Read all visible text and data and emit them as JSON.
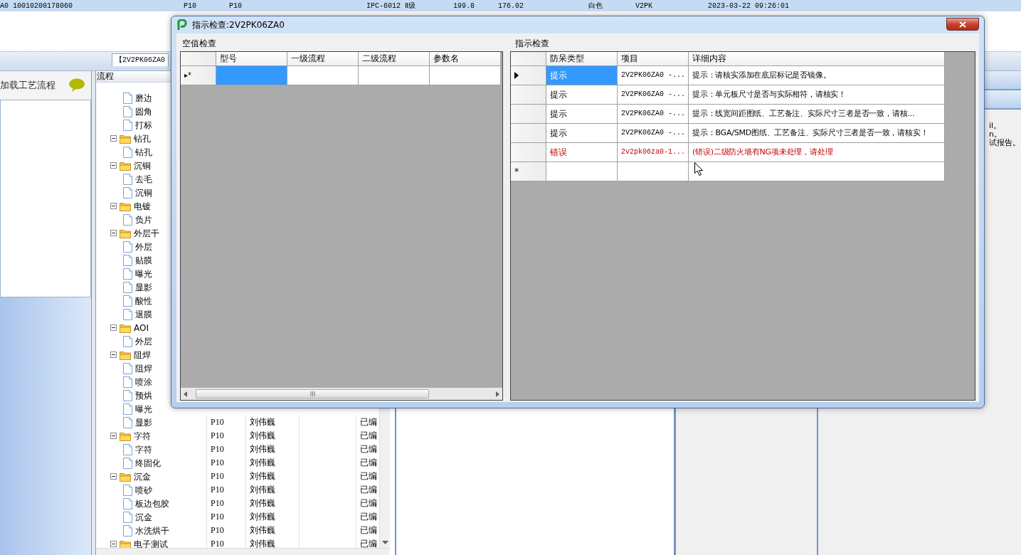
{
  "top_row": {
    "selected": true,
    "cells": [
      "A0",
      "10010200178060",
      "P10",
      "P10",
      "IPC-6012 Ⅱ级",
      "199.8",
      "176.02",
      "白色",
      "V2PK",
      "2023-03-22 09:26:01"
    ]
  },
  "tab": {
    "label": "【2V2PK06ZA0",
    "selected": true
  },
  "left_panel": {
    "title": "加载工艺流程"
  },
  "tree": {
    "header": "流程",
    "items": [
      {
        "children": [
          {
            "label": "磨边"
          },
          {
            "label": "圆角"
          },
          {
            "label": "打标"
          }
        ]
      },
      {
        "label": "钻孔",
        "expanded": true,
        "children": [
          {
            "label": "钻孔"
          }
        ]
      },
      {
        "label": "沉铜",
        "expanded": true,
        "children": [
          {
            "label": "去毛"
          },
          {
            "label": "沉铜"
          }
        ]
      },
      {
        "label": "电镀",
        "expanded": true,
        "children": [
          {
            "label": "负片"
          }
        ]
      },
      {
        "label": "外层干",
        "expanded": true,
        "children": [
          {
            "label": "外层"
          },
          {
            "label": "贴膜"
          },
          {
            "label": "曝光"
          },
          {
            "label": "显影"
          },
          {
            "label": "酸性"
          },
          {
            "label": "退膜"
          }
        ]
      },
      {
        "label": "AOI",
        "expanded": true,
        "children": [
          {
            "label": "外层"
          }
        ]
      },
      {
        "label": "阻焊",
        "expanded": true,
        "children": [
          {
            "label": "阻焊"
          },
          {
            "label": "喷涂"
          },
          {
            "label": "预烘"
          },
          {
            "label": "曝光"
          },
          {
            "label": "显影",
            "cells": [
              "P10",
              "刘伟巍",
              "已编"
            ]
          }
        ]
      },
      {
        "label": "字符",
        "expanded": true,
        "cells": [
          "P10",
          "刘伟巍",
          "已编"
        ],
        "children": [
          {
            "label": "字符",
            "cells": [
              "P10",
              "刘伟巍",
              "已编"
            ]
          },
          {
            "label": "终固化",
            "cells": [
              "P10",
              "刘伟巍",
              "已编"
            ]
          }
        ]
      },
      {
        "label": "沉金",
        "expanded": true,
        "cells": [
          "P10",
          "刘伟巍",
          "已编"
        ],
        "children": [
          {
            "label": "喷砂",
            "cells": [
              "P10",
              "刘伟巍",
              "已编"
            ]
          },
          {
            "label": "板边包胶",
            "cells": [
              "P10",
              "刘伟巍",
              "已编"
            ]
          },
          {
            "label": "沉金",
            "cells": [
              "P10",
              "刘伟巍",
              "已编"
            ]
          },
          {
            "label": "水洗烘干",
            "cells": [
              "P10",
              "刘伟巍",
              "已编"
            ]
          }
        ]
      },
      {
        "label": "电子测试",
        "expanded": true,
        "cells": [
          "P10",
          "刘伟巍",
          "已编"
        ]
      }
    ]
  },
  "notes_panel": {
    "lines": [
      "il。",
      "n。",
      "试报告。"
    ]
  },
  "dialog": {
    "title": "指示检查:2V2PK06ZA0",
    "empty_check": {
      "title": "空值检查",
      "columns": [
        "型号",
        "一级流程",
        "二级流程",
        "参数名"
      ],
      "new_row": {
        "marker": "▸*",
        "selected": true
      }
    },
    "hint_check": {
      "title": "指示检查",
      "columns": [
        "防呆类型",
        "项目",
        "详细内容"
      ],
      "rows": [
        {
          "kind": "hint",
          "current": true,
          "selected": true,
          "type": "提示",
          "item": "2V2PK06ZA0 -...",
          "detail": "提示：请核实添加在底层标记是否镜像。"
        },
        {
          "kind": "hint",
          "current": false,
          "selected": false,
          "type": "提示",
          "item": "2V2PK06ZA0 -...",
          "detail": "提示：单元板尺寸是否与实际相符，请核实！"
        },
        {
          "kind": "hint",
          "current": false,
          "selected": false,
          "type": "提示",
          "item": "2V2PK06ZA0 -...",
          "detail": "提示：线宽间距图纸、工艺备注、实际尺寸三者是否一致，请核..."
        },
        {
          "kind": "hint",
          "current": false,
          "selected": false,
          "type": "提示",
          "item": "2V2PK06ZA0 -...",
          "detail": "提示：BGA/SMD图纸、工艺备注、实际尺寸三者是否一致，请核实！"
        },
        {
          "kind": "error",
          "current": false,
          "selected": false,
          "type": "错误",
          "item": "2v2pk06za0-1...",
          "detail": "(错误)二级防火墙有NG项未处理，请处理"
        }
      ],
      "new_row": {
        "marker": "*"
      }
    }
  }
}
